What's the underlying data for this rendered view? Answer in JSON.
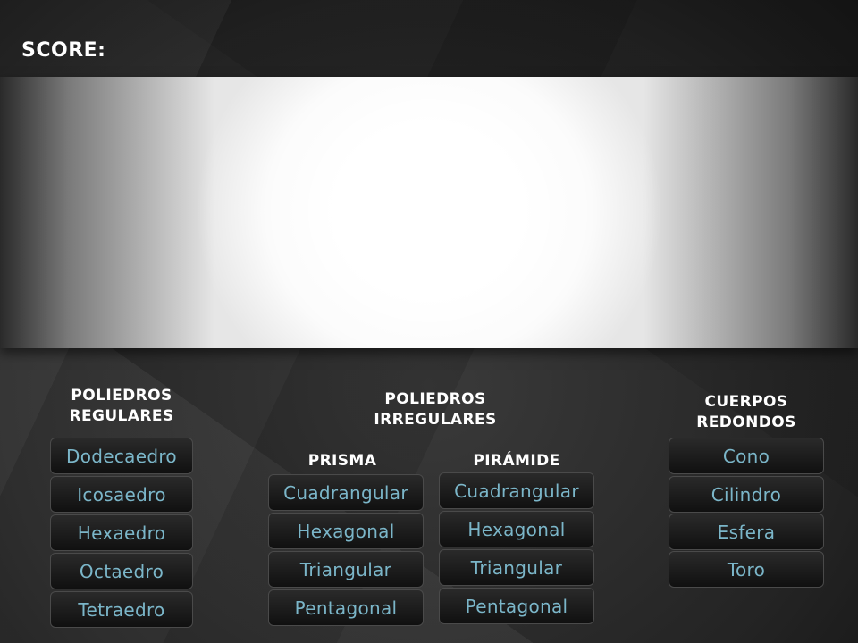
{
  "score_label": "SCORE:",
  "regulares": {
    "title_line1": "POLIEDROS",
    "title_line2": "REGULARES",
    "items": [
      "Dodecaedro",
      "Icosaedro",
      "Hexaedro",
      "Octaedro",
      "Tetraedro"
    ]
  },
  "irregulares": {
    "title_line1": "POLIEDROS",
    "title_line2": "IRREGULARES",
    "prisma": {
      "title": "PRISMA",
      "items": [
        "Cuadrangular",
        "Hexagonal",
        "Triangular",
        "Pentagonal"
      ]
    },
    "piramide": {
      "title": "PIRÁMIDE",
      "items": [
        "Cuadrangular",
        "Hexagonal",
        "Triangular",
        "Pentagonal"
      ]
    }
  },
  "redondos": {
    "title_line1": "CUERPOS",
    "title_line2": "REDONDOS",
    "items": [
      "Cono",
      "Cilindro",
      "Esfera",
      "Toro"
    ]
  }
}
